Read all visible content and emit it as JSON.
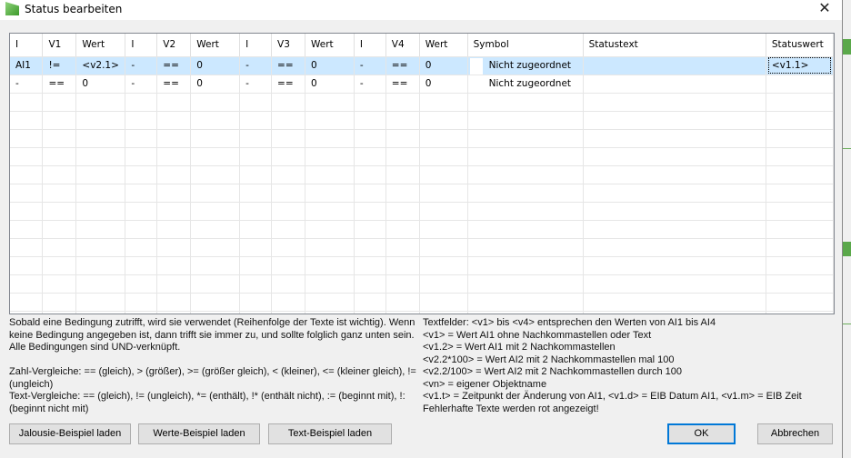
{
  "window": {
    "title": "Status bearbeiten",
    "close": "✕"
  },
  "table": {
    "headers": [
      "I",
      "V1",
      "Wert",
      "I",
      "V2",
      "Wert",
      "I",
      "V3",
      "Wert",
      "I",
      "V4",
      "Wert",
      "Symbol",
      "Statustext",
      "Statuswert"
    ],
    "rows": [
      [
        "AI1",
        "!=",
        "<v2.1>",
        "-",
        "==",
        "0",
        "-",
        "==",
        "0",
        "-",
        "==",
        "0",
        "Nicht zugeordnet",
        "",
        "<v1.1>"
      ],
      [
        "-",
        "==",
        "0",
        "-",
        "==",
        "0",
        "-",
        "==",
        "0",
        "-",
        "==",
        "0",
        "Nicht zugeordnet",
        "",
        ""
      ]
    ],
    "selected_row": 0
  },
  "help_left": [
    "Sobald eine Bedingung zutrifft, wird sie verwendet (Reihenfolge der Texte ist wichtig). Wenn keine Bedingung angegeben ist, dann trifft sie immer zu, und sollte folglich ganz unten sein. Alle Bedingungen sind UND-verknüpft.",
    "",
    "Zahl-Vergleiche: == (gleich), > (größer), >= (größer gleich), < (kleiner), <= (kleiner gleich), != (ungleich)",
    "Text-Vergleiche: == (gleich), != (ungleich), *= (enthält), !* (enthält nicht), := (beginnt mit), !: (beginnt nicht mit)"
  ],
  "help_right": [
    "Textfelder: <v1> bis <v4> entsprechen den Werten von AI1 bis AI4",
    "<v1> = Wert AI1 ohne Nachkommastellen oder Text",
    "<v1.2> = Wert AI1 mit 2 Nachkommastellen",
    "<v2.2*100> = Wert AI2 mit 2 Nachkommastellen mal 100",
    "<v2.2/100> = Wert AI2 mit 2 Nachkommastellen durch 100",
    "<vn> = eigener Objektname",
    "<v1.t> = Zeitpunkt der Änderung von AI1, <v1.d> = EIB Datum AI1, <v1.m> = EIB Zeit",
    "Fehlerhafte Texte werden rot angezeigt!"
  ],
  "buttons": {
    "jalousie": "Jalousie-Beispiel laden",
    "werte": "Werte-Beispiel laden",
    "text": "Text-Beispiel laden",
    "ok": "OK",
    "cancel": "Abbrechen"
  }
}
